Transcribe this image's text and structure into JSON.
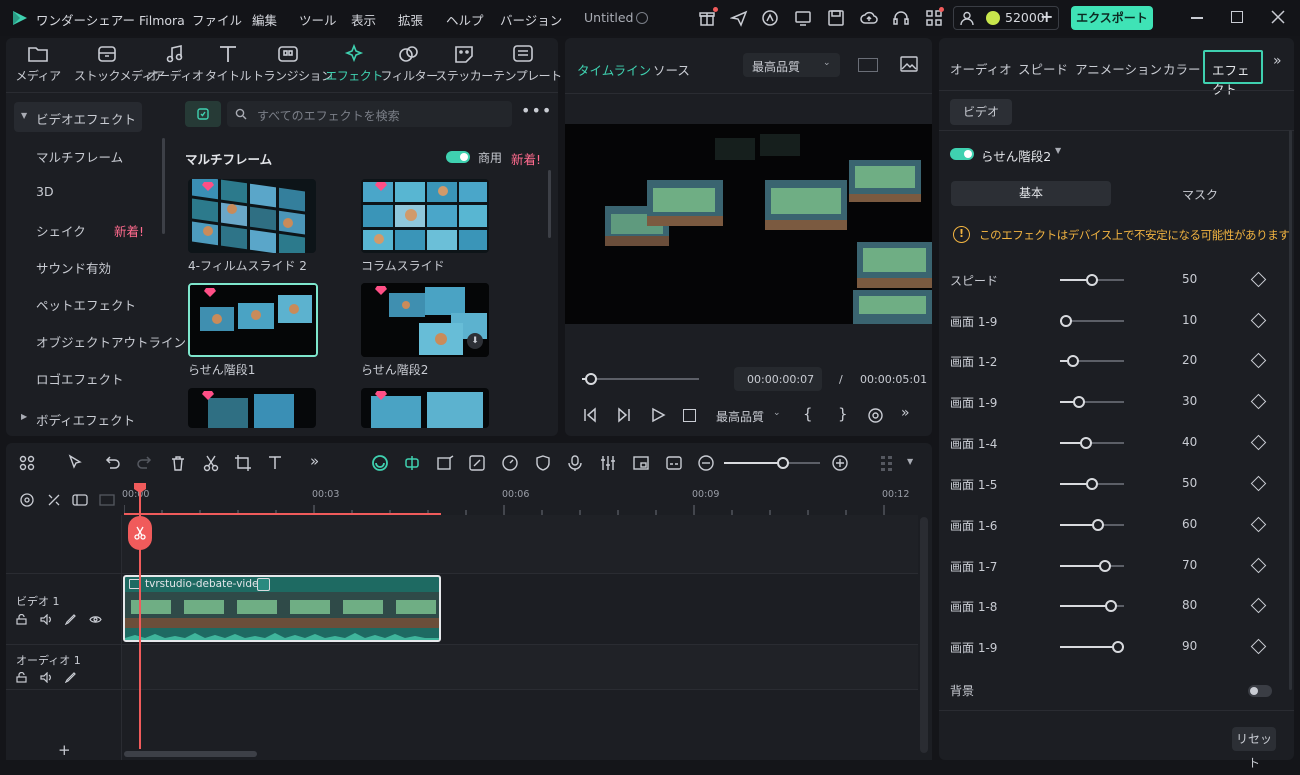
{
  "titlebar": {
    "app_name": "ワンダーシェアー Filmora",
    "menu": [
      "ファイル",
      "編集",
      "ツール",
      "表示",
      "拡張",
      "ヘルプ",
      "バージョン"
    ],
    "project": "Untitled",
    "credits": "52000",
    "export_label": "エクスポート"
  },
  "toolbar": {
    "tools": [
      {
        "label": "メディア",
        "icon": "folder-icon"
      },
      {
        "label": "ストックメディア",
        "icon": "stock-media-icon"
      },
      {
        "label": "オーディオ",
        "icon": "music-note-icon"
      },
      {
        "label": "タイトル",
        "icon": "title-t-icon"
      },
      {
        "label": "トランジション",
        "icon": "transition-icon"
      },
      {
        "label": "エフェクト",
        "icon": "effects-sparkle-icon"
      },
      {
        "label": "フィルター",
        "icon": "filter-icon"
      },
      {
        "label": "ステッカー",
        "icon": "sticker-icon"
      },
      {
        "label": "テンプレート",
        "icon": "template-icon"
      }
    ]
  },
  "library": {
    "categories": [
      {
        "label": "ビデオエフェクト"
      },
      {
        "label": "マルチフレーム"
      },
      {
        "label": "3D"
      },
      {
        "label": "シェイク",
        "badge": "新着!"
      },
      {
        "label": "サウンド有効"
      },
      {
        "label": "ペットエフェクト"
      },
      {
        "label": "オブジェクトアウトライン"
      },
      {
        "label": "ロゴエフェクト"
      },
      {
        "label": "ボディエフェクト"
      }
    ],
    "search_placeholder": "すべてのエフェクトを検索",
    "section_title": "マルチフレーム",
    "commercial_label": "商用",
    "new_label": "新着!",
    "items": [
      {
        "label": "4-フィルムスライド 2"
      },
      {
        "label": "コラムスライド"
      },
      {
        "label": "らせん階段1"
      },
      {
        "label": "らせん階段2"
      }
    ]
  },
  "preview": {
    "tabs": [
      "タイムライン",
      "ソース"
    ],
    "quality": "最高品質",
    "current_time": "00:00:00:07",
    "separator": "/",
    "total_time": "00:00:05:01",
    "playback_quality": "最高品質"
  },
  "right_panel": {
    "tabs": [
      "オーディオ",
      "スピード",
      "アニメーション",
      "カラー",
      "エフェクト"
    ],
    "subtab": "ビデオ",
    "effect_name": "らせん階段2",
    "mode_tabs": [
      "基本",
      "マスク"
    ],
    "warning": "このエフェクトはデバイス上で不安定になる可能性があります",
    "params": [
      {
        "label": "スピード",
        "value": 50
      },
      {
        "label": "画面 1-9",
        "value": 10
      },
      {
        "label": "画面 1-2",
        "value": 20
      },
      {
        "label": "画面 1-9",
        "value": 30
      },
      {
        "label": "画面 1-4",
        "value": 40
      },
      {
        "label": "画面 1-5",
        "value": 50
      },
      {
        "label": "画面 1-6",
        "value": 60
      },
      {
        "label": "画面 1-7",
        "value": 70
      },
      {
        "label": "画面 1-8",
        "value": 80
      },
      {
        "label": "画面 1-9",
        "value": 90
      }
    ],
    "background_label": "背景",
    "reset_label": "リセット"
  },
  "timeline": {
    "ruler": [
      "00:00",
      "00:03",
      "00:06",
      "00:09",
      "00:12"
    ],
    "tracks": [
      {
        "label": "ビデオ 1"
      },
      {
        "label": "オーディオ 1"
      }
    ],
    "clip_name": "tvrstudio-debate-video"
  },
  "colors": {
    "accent": "#3fd1b0",
    "export_bg": "#3fe3b6",
    "playhead": "#f05b5b",
    "clip": "#1e6a62",
    "new_badge": "#ff6b8e"
  }
}
